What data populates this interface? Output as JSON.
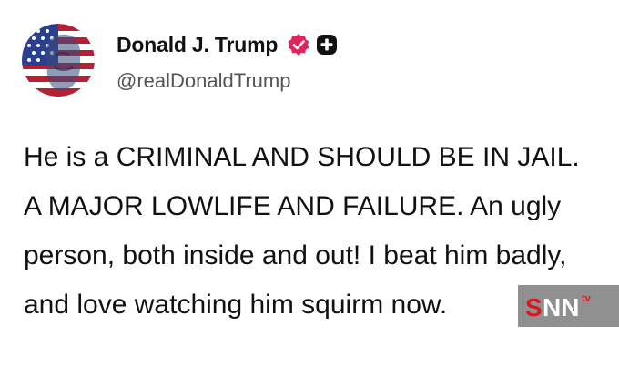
{
  "post": {
    "author": {
      "display_name": "Donald J. Trump",
      "handle": "@realDonaldTrump",
      "avatar_icon": "flag-portrait-avatar",
      "verified_icon": "verified-badge-icon",
      "verified_color": "#e0245e",
      "plus_icon": "plus-badge-icon"
    },
    "text": "He is a CRIMINAL AND SHOULD BE IN JAIL. A MAJOR LOWLIFE AND FAILURE. An ugly person, both inside and out! I beat him badly, and love watching him squirm now."
  },
  "watermark": {
    "logo_text": "SNN",
    "accent_color": "#d71920",
    "tv_text": "tv"
  }
}
